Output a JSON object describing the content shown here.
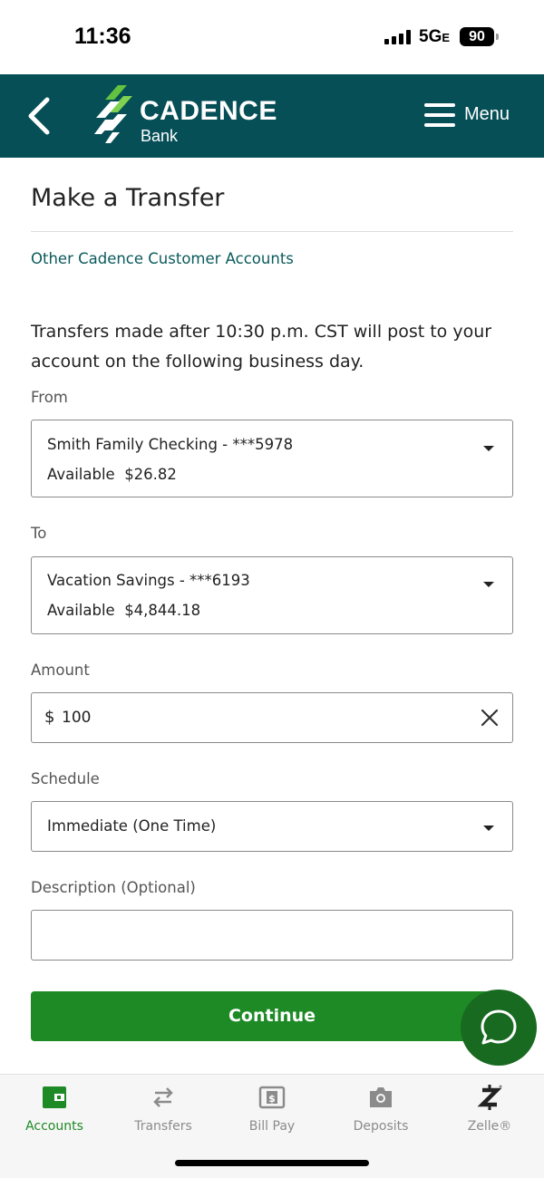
{
  "status_bar": {
    "time": "11:36",
    "network": "5G",
    "network_suffix": "E",
    "battery": "90"
  },
  "header": {
    "brand_name": "CADENCE",
    "brand_sub": "Bank",
    "menu_label": "Menu",
    "back_icon": "chevron-left-icon",
    "menu_icon": "hamburger-icon",
    "background_color": "#064f57"
  },
  "page": {
    "title": "Make a Transfer",
    "other_accounts_link": "Other Cadence Customer Accounts",
    "notice": "Transfers made after 10:30 p.m. CST will post to your account on the following business day."
  },
  "form": {
    "from": {
      "label": "From",
      "account": "Smith Family Checking - ***5978",
      "available_label": "Available",
      "available_amount": "$26.82"
    },
    "to": {
      "label": "To",
      "account": "Vacation Savings - ***6193",
      "available_label": "Available",
      "available_amount": "$4,844.18"
    },
    "amount": {
      "label": "Amount",
      "currency": "$",
      "value": "100"
    },
    "schedule": {
      "label": "Schedule",
      "value": "Immediate (One Time)"
    },
    "description": {
      "label": "Description (Optional)",
      "value": ""
    },
    "continue_label": "Continue"
  },
  "bottom_nav": {
    "items": [
      {
        "label": "Accounts",
        "icon": "wallet-icon",
        "active": true
      },
      {
        "label": "Transfers",
        "icon": "transfer-arrows-icon",
        "active": false
      },
      {
        "label": "Bill Pay",
        "icon": "bill-icon",
        "active": false
      },
      {
        "label": "Deposits",
        "icon": "camera-icon",
        "active": false
      },
      {
        "label": "Zelle®",
        "icon": "zelle-icon",
        "active": false
      }
    ]
  },
  "colors": {
    "accent_green": "#1e8a25",
    "chat_green": "#196a21",
    "link_teal": "#0b5a5c"
  }
}
